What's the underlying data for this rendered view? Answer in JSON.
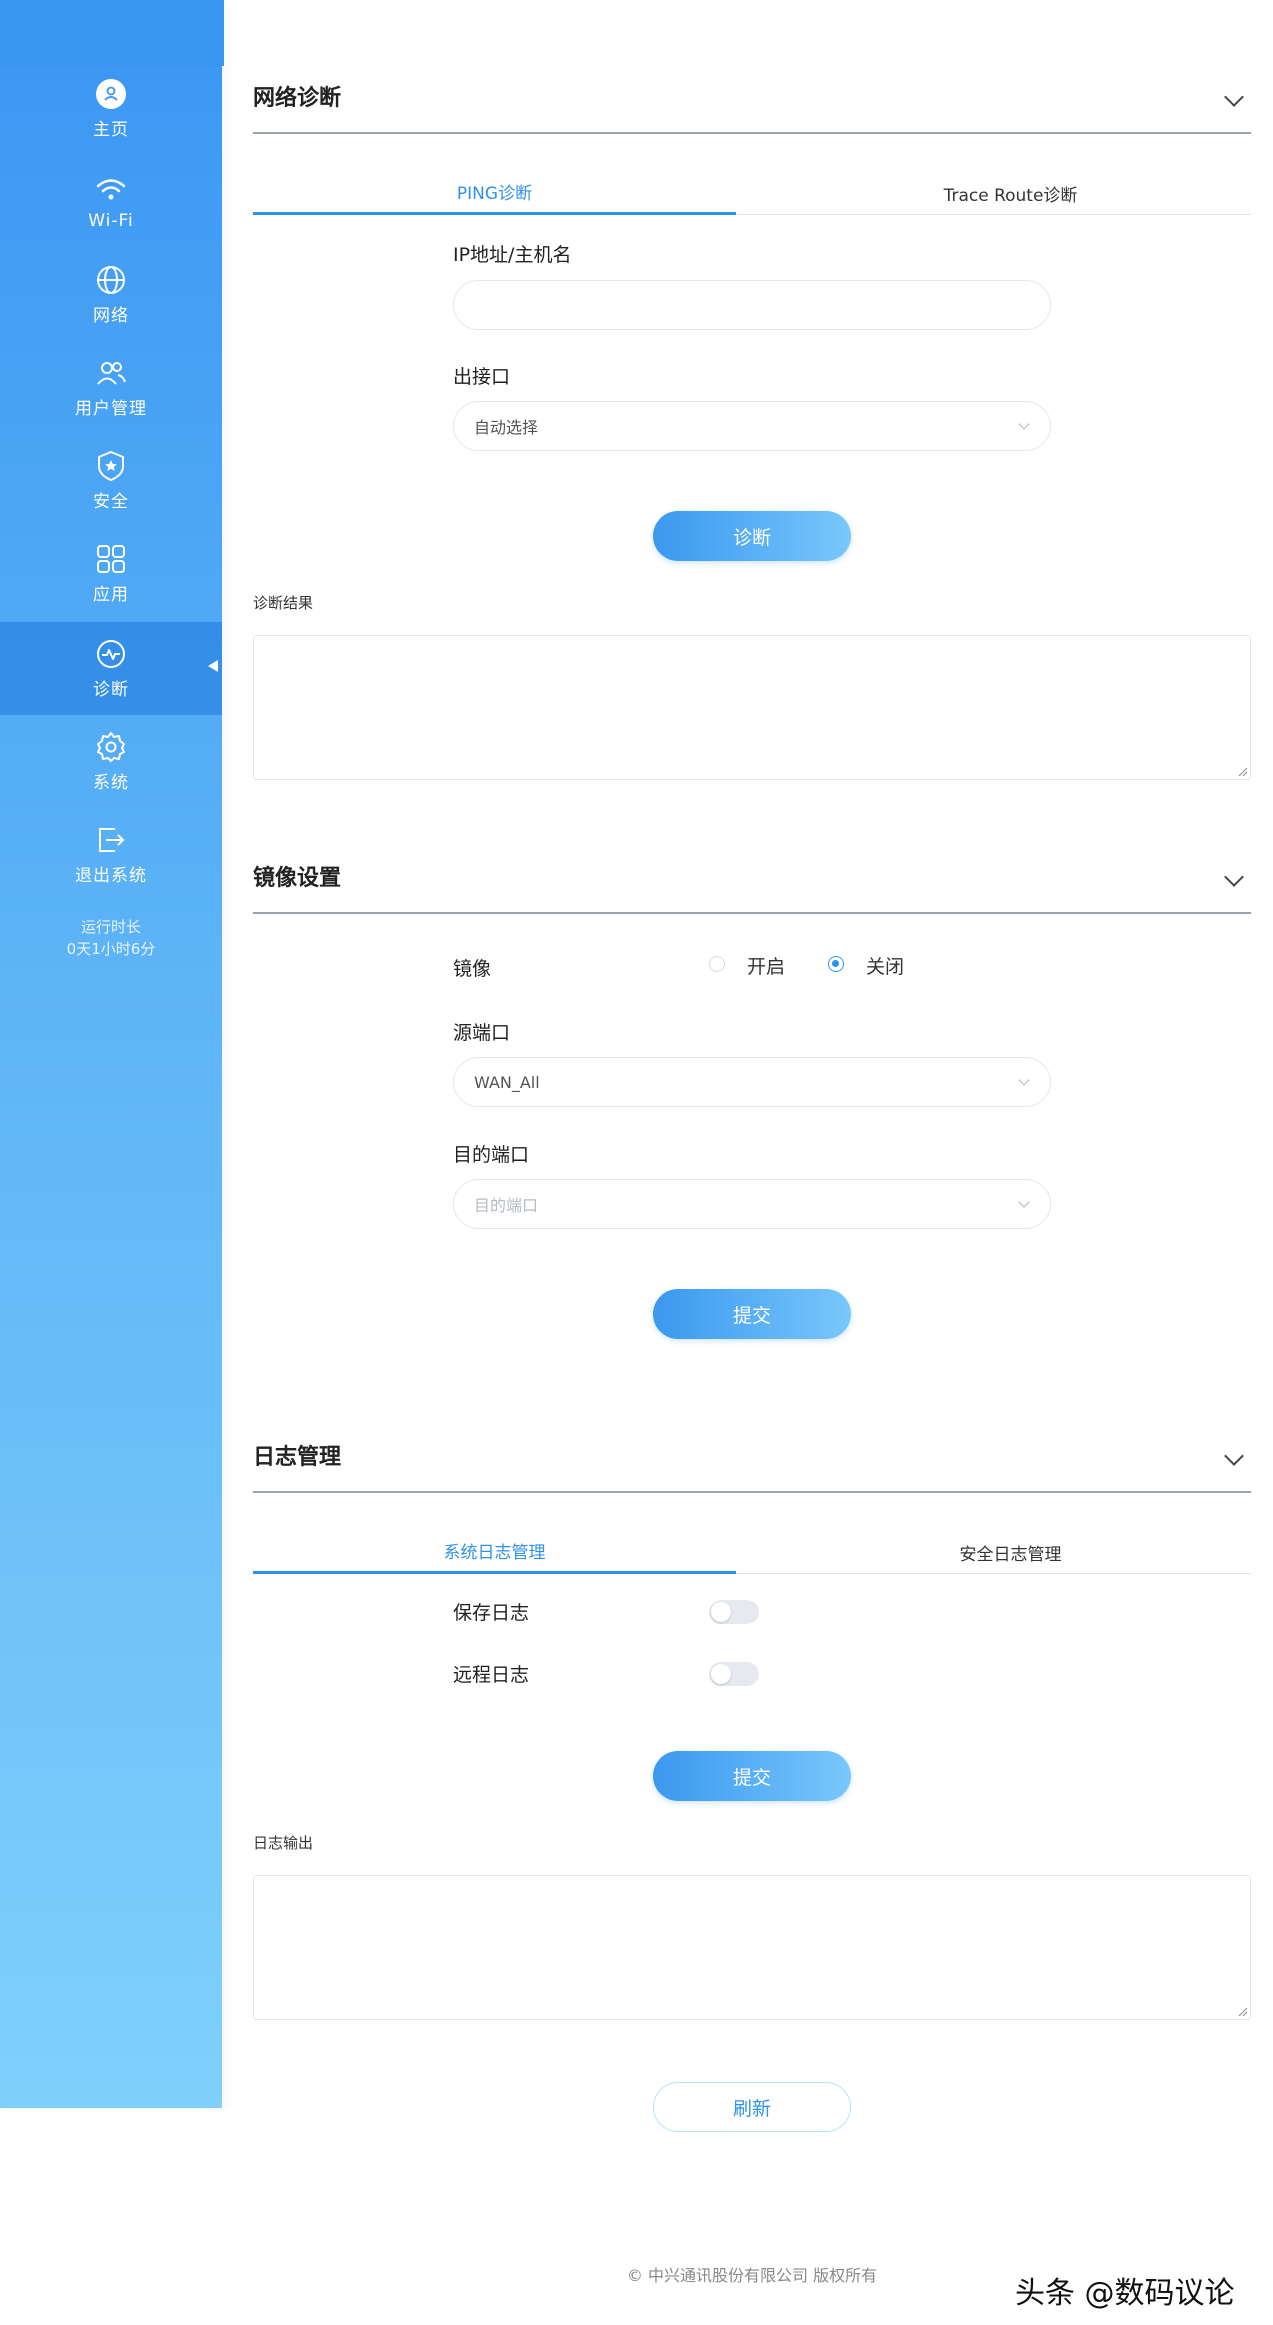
{
  "sidebar": {
    "items": [
      {
        "label": "主页",
        "icon": "home-user-icon"
      },
      {
        "label": "Wi-Fi",
        "icon": "wifi-icon"
      },
      {
        "label": "网络",
        "icon": "globe-icon"
      },
      {
        "label": "用户管理",
        "icon": "users-icon"
      },
      {
        "label": "安全",
        "icon": "shield-star-icon"
      },
      {
        "label": "应用",
        "icon": "apps-grid-icon"
      },
      {
        "label": "诊断",
        "icon": "pulse-icon",
        "active": true
      },
      {
        "label": "系统",
        "icon": "gear-icon"
      },
      {
        "label": "退出系统",
        "icon": "logout-icon"
      }
    ],
    "uptime_label": "运行时长",
    "uptime_value": "0天1小时6分"
  },
  "network_diag": {
    "title": "网络诊断",
    "tabs": [
      "PING诊断",
      "Trace Route诊断"
    ],
    "ip_label": "IP地址/主机名",
    "ip_value": "",
    "iface_label": "出接口",
    "iface_value": "自动选择",
    "diag_button": "诊断",
    "result_label": "诊断结果"
  },
  "mirror": {
    "title": "镜像设置",
    "mirror_label": "镜像",
    "opt_on": "开启",
    "opt_off": "关闭",
    "selected": "关闭",
    "src_label": "源端口",
    "src_value": "WAN_All",
    "dst_label": "目的端口",
    "dst_placeholder": "目的端口",
    "submit": "提交"
  },
  "logs": {
    "title": "日志管理",
    "tabs": [
      "系统日志管理",
      "安全日志管理"
    ],
    "save_log_label": "保存日志",
    "remote_log_label": "远程日志",
    "save_log_on": false,
    "remote_log_on": false,
    "submit": "提交",
    "output_label": "日志输出",
    "refresh": "刷新"
  },
  "footer": "© 中兴通讯股份有限公司 版权所有",
  "watermark": "头条 @数码议论",
  "colors": {
    "accent": "#2f92ea",
    "sidebar_top": "#3a96f3",
    "sidebar_bottom": "#7fd0fb"
  }
}
